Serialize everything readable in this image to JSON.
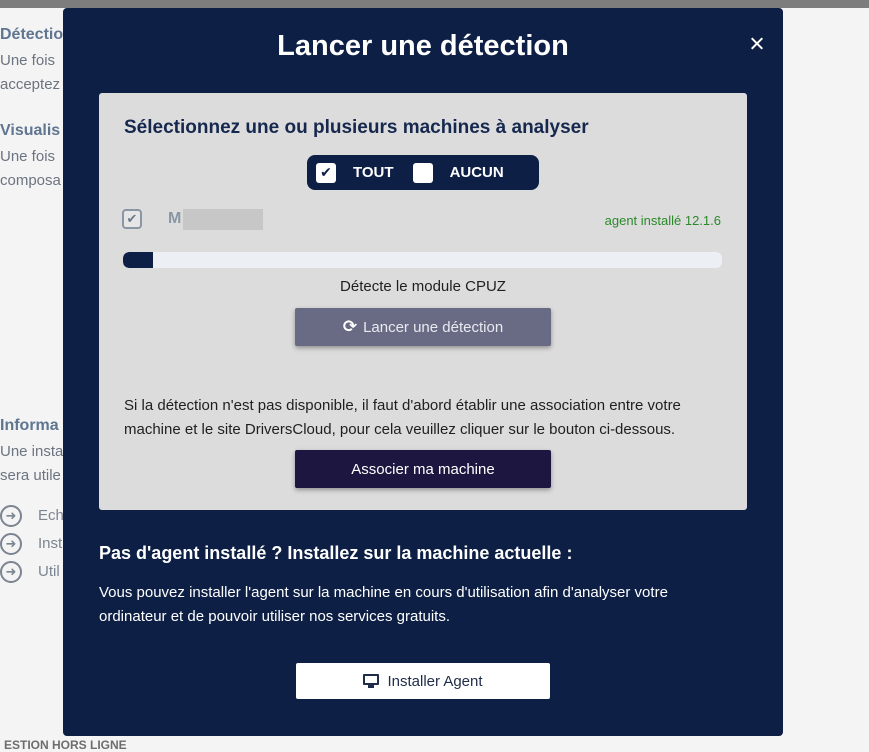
{
  "background": {
    "lines": [
      {
        "text": "Détectio",
        "heading": true
      },
      {
        "text": "Une fois",
        "heading": false
      },
      {
        "text": "acceptez",
        "heading": false
      },
      {
        "text": "Visualis",
        "heading": true
      },
      {
        "text": "Une fois",
        "heading": false
      },
      {
        "text": "composa",
        "heading": false
      },
      {
        "text": "Informa",
        "heading": true
      },
      {
        "text": "Une insta",
        "heading": false
      },
      {
        "text": "sera utile",
        "heading": false
      }
    ],
    "bullets": [
      "Ech",
      "Inst",
      "Util"
    ],
    "footer": "ESTION HORS LIGNE"
  },
  "modal": {
    "title": "Lancer une détection",
    "close_icon": "close-icon"
  },
  "panel": {
    "title": "Sélectionnez une ou plusieurs machines à analyser",
    "select_all_label": "TOUT",
    "select_none_label": "AUCUN",
    "select_all_checked": true,
    "select_none_checked": false,
    "machine": {
      "name": "M",
      "checked": true,
      "status": "agent installé 12.1.6"
    },
    "progress": 0.05,
    "progress_text": "Détecte le module CPUZ",
    "detect_button": "Lancer une détection",
    "detect_icon": "refresh-icon",
    "association_text": "Si la détection n'est pas disponible, il faut d'abord établir une association entre votre machine et le site DriversCloud, pour cela veuillez cliquer sur le bouton ci-dessous.",
    "associate_button": "Associer ma machine"
  },
  "agent": {
    "title": "Pas d'agent installé ? Installez sur la machine actuelle :",
    "description": "Vous pouvez installer l'agent sur la machine en cours d'utilisation afin d'analyser votre ordinateur et de pouvoir utiliser nos services gratuits.",
    "install_button": "Installer Agent",
    "install_icon": "monitor-icon"
  },
  "colors": {
    "modal_bg": "#0d1f45",
    "panel_bg": "#dcdcdc",
    "status_green": "#2a8a2a"
  }
}
